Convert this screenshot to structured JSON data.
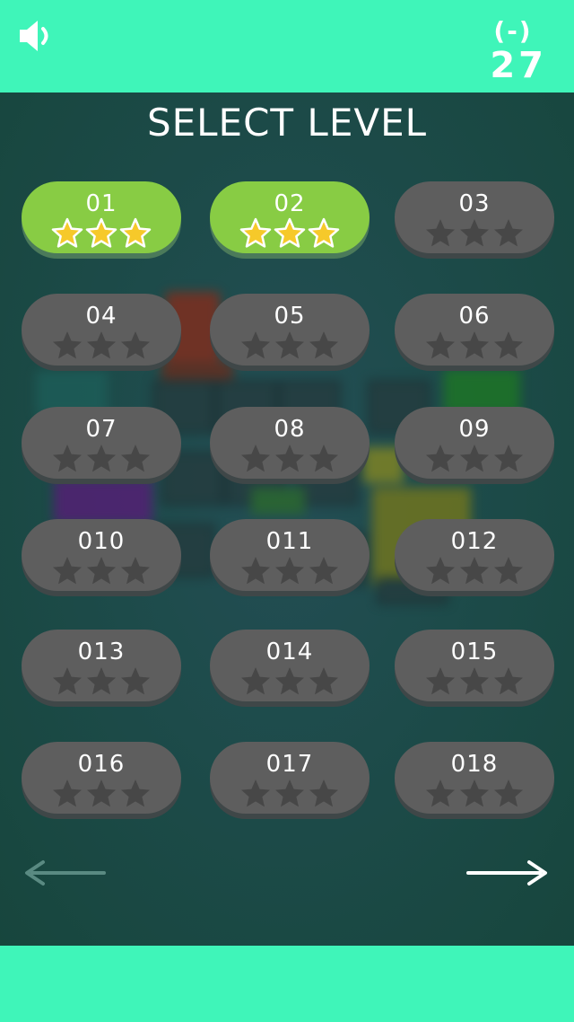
{
  "header": {
    "sound_icon": "speaker-icon",
    "score_sub": "(-)",
    "score": "27"
  },
  "title": "SELECT LEVEL",
  "colors": {
    "accent": "#3ff5b9",
    "completed": "#88cc44",
    "locked": "#5e5e5e",
    "star_gold": "#f6c92a",
    "star_empty": "#474747"
  },
  "levels": [
    {
      "label": "01",
      "stars": 3,
      "completed": true
    },
    {
      "label": "02",
      "stars": 3,
      "completed": true
    },
    {
      "label": "03",
      "stars": 0,
      "completed": false
    },
    {
      "label": "04",
      "stars": 0,
      "completed": false
    },
    {
      "label": "05",
      "stars": 0,
      "completed": false
    },
    {
      "label": "06",
      "stars": 0,
      "completed": false
    },
    {
      "label": "07",
      "stars": 0,
      "completed": false
    },
    {
      "label": "08",
      "stars": 0,
      "completed": false
    },
    {
      "label": "09",
      "stars": 0,
      "completed": false
    },
    {
      "label": "010",
      "stars": 0,
      "completed": false
    },
    {
      "label": "011",
      "stars": 0,
      "completed": false
    },
    {
      "label": "012",
      "stars": 0,
      "completed": false
    },
    {
      "label": "013",
      "stars": 0,
      "completed": false
    },
    {
      "label": "014",
      "stars": 0,
      "completed": false
    },
    {
      "label": "015",
      "stars": 0,
      "completed": false
    },
    {
      "label": "016",
      "stars": 0,
      "completed": false
    },
    {
      "label": "017",
      "stars": 0,
      "completed": false
    },
    {
      "label": "018",
      "stars": 0,
      "completed": false
    }
  ],
  "nav": {
    "prev_icon": "arrow-left-icon",
    "next_icon": "arrow-right-icon",
    "prev_enabled": false,
    "next_enabled": true
  }
}
